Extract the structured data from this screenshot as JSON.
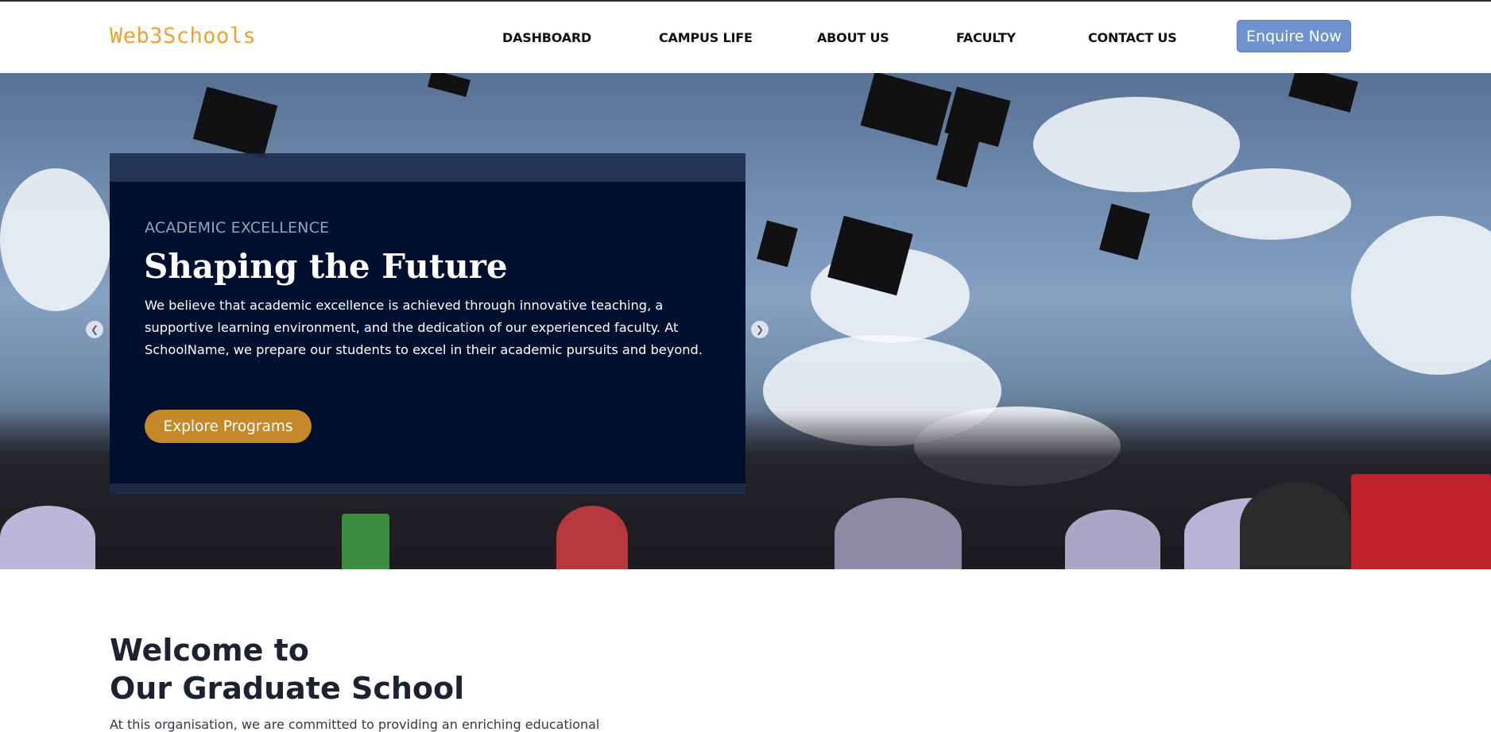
{
  "brand": "Web3Schools",
  "nav": {
    "items": [
      "DASHBOARD",
      "CAMPUS LIFE",
      "ABOUT US",
      "FACULTY",
      "CONTACT US"
    ],
    "cta": "Enquire Now"
  },
  "hero": {
    "eyebrow": "ACADEMIC EXCELLENCE",
    "title": "Shaping the Future",
    "description": "We believe that academic excellence is achieved through innovative teaching, a supportive learning environment, and the dedication of our experienced faculty. At SchoolName, we prepare our students to excel in their academic pursuits and beyond.",
    "button": "Explore Programs",
    "prev_icon": "chevron-left-icon",
    "next_icon": "chevron-right-icon"
  },
  "welcome": {
    "title_line1": "Welcome to",
    "title_line2": "Our Graduate School",
    "text": "At this organisation, we are committed to providing an enriching educational"
  },
  "colors": {
    "brand": "#f0a030",
    "cta": "#7093d0",
    "slide_bg": "#000f2e",
    "explore": "#c6892a"
  }
}
